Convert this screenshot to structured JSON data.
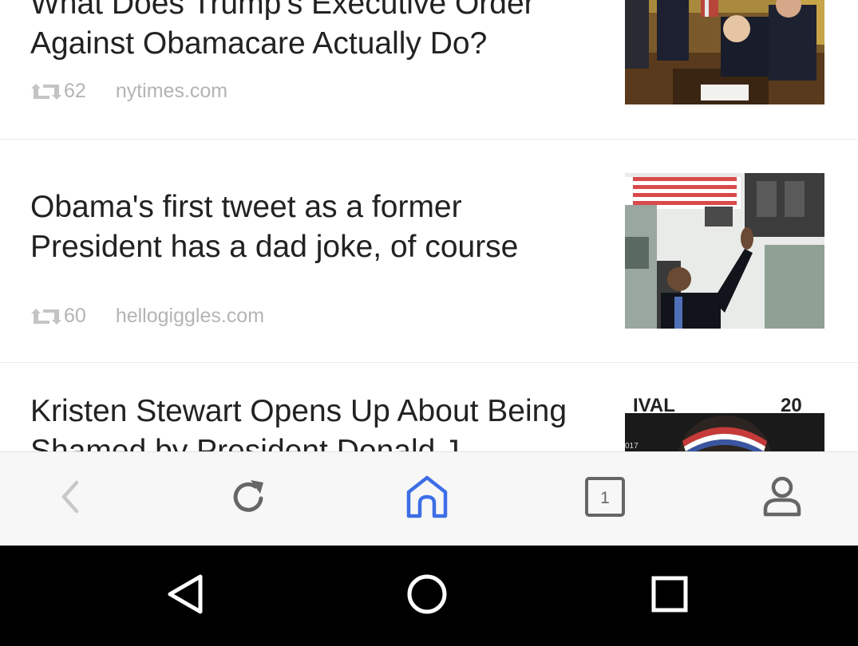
{
  "feed": {
    "articles": [
      {
        "title": "What Does Trump's Executive Order Against Obamacare Actually Do?",
        "shares": "62",
        "source": "nytimes.com",
        "thumbnail": "photo-oval-office-signing"
      },
      {
        "title": "Obama's first tweet as a former President has a dad joke, of course",
        "shares": "60",
        "source": "hellogiggles.com",
        "thumbnail": "photo-obama-waving-helicopter"
      },
      {
        "title": "Kristen Stewart Opens Up About Being Shamed by President Donald J",
        "thumbnail": "photo-kristen-stewart-event"
      }
    ]
  },
  "toolbar": {
    "tab_count": "1",
    "icons": [
      "back-icon",
      "reload-icon",
      "home-icon",
      "tabs-icon",
      "profile-icon"
    ],
    "accent": "#3c6ee6",
    "inactive": "#666666",
    "disabled": "#c8c8c8"
  },
  "navbar": {
    "icons": [
      "nav-back-icon",
      "nav-home-icon",
      "nav-recents-icon"
    ]
  },
  "colors": {
    "title": "#222222",
    "meta": "#b4b4b4",
    "divider": "#ececec",
    "toolbar_bg": "#f7f7f7",
    "navbar_bg": "#000000"
  }
}
